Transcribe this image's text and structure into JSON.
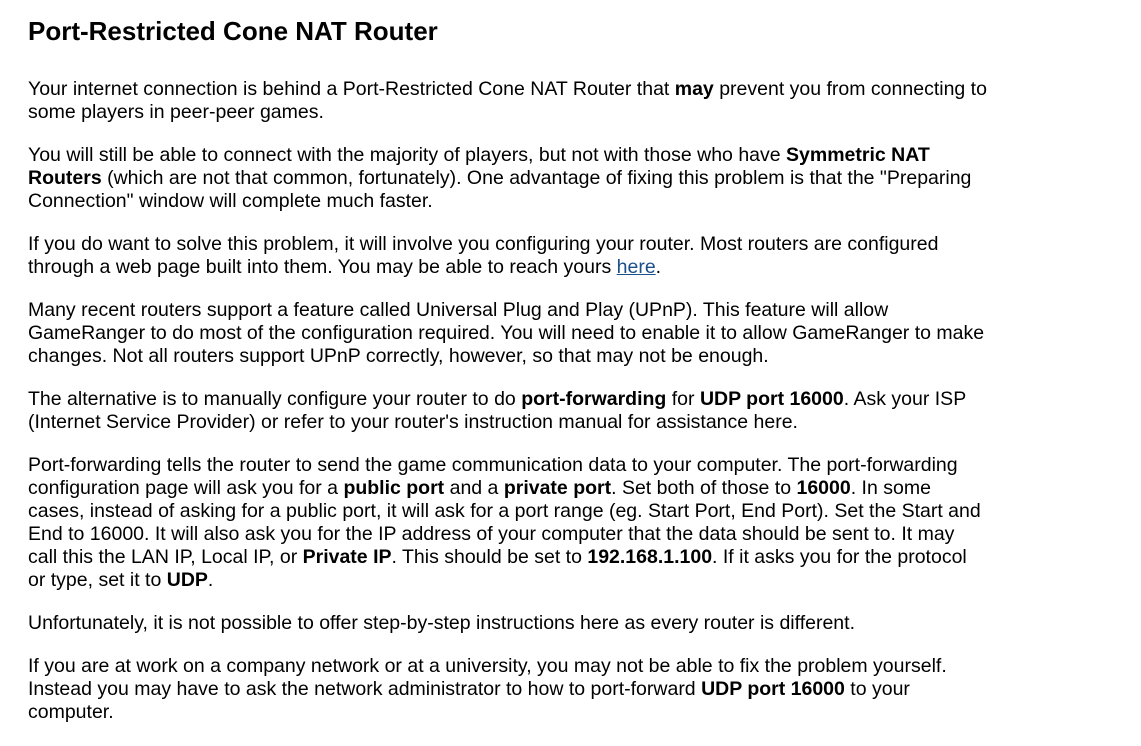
{
  "title": "Port-Restricted Cone NAT Router",
  "p1": {
    "a": "Your internet connection is behind a Port-Restricted Cone NAT Router that ",
    "b": "may",
    "c": " prevent you from connecting to some players in peer-peer games."
  },
  "p2": {
    "a": "You will still be able to connect with the majority of players, but not with those who have ",
    "b": "Symmetric NAT Routers",
    "c": " (which are not that common, fortunately). One advantage of fixing this problem is that the \"Preparing Connection\" window will complete much faster."
  },
  "p3": {
    "a": "If you do want to solve this problem, it will involve you configuring your router. Most routers are configured through a web page built into them. You may be able to reach yours ",
    "link": "here",
    "c": "."
  },
  "p4": {
    "a": "Many recent routers support a feature called Universal Plug and Play (UPnP). This feature will allow GameRanger to do most of the configuration required. You will need to enable it to allow GameRanger to make changes. Not all routers support UPnP correctly, however, so that may not be enough."
  },
  "p5": {
    "a": "The alternative is to manually configure your router to do ",
    "b": "port-forwarding",
    "c": " for ",
    "d": "UDP port 16000",
    "e": ". Ask your ISP (Internet Service Provider) or refer to your router's instruction manual for assistance here."
  },
  "p6": {
    "a": "Port-forwarding tells the router to send the game communication data to your computer. The port-forwarding configuration page will ask you for a ",
    "b": "public port",
    "c": " and a ",
    "d": "private port",
    "e": ". Set both of those to ",
    "f": "16000",
    "g": ". In some cases, instead of asking for a public port, it will ask for a port range (eg. Start Port, End Port). Set the Start and End to 16000. It will also ask you for the IP address of your computer that the data should be sent to. It may call this the LAN IP, Local IP, or ",
    "h": "Private IP",
    "i": ". This should be set to ",
    "j": "192.168.1.100",
    "k": ". If it asks you for the protocol or type, set it to ",
    "l": "UDP",
    "m": "."
  },
  "p7": {
    "a": "Unfortunately, it is not possible to offer step-by-step instructions here as every router is different."
  },
  "p8": {
    "a": "If you are at work on a company network or at a university, you may not be able to fix the problem yourself. Instead you may have to ask the network administrator to how to port-forward ",
    "b": "UDP port 16000",
    "c": " to your computer."
  }
}
